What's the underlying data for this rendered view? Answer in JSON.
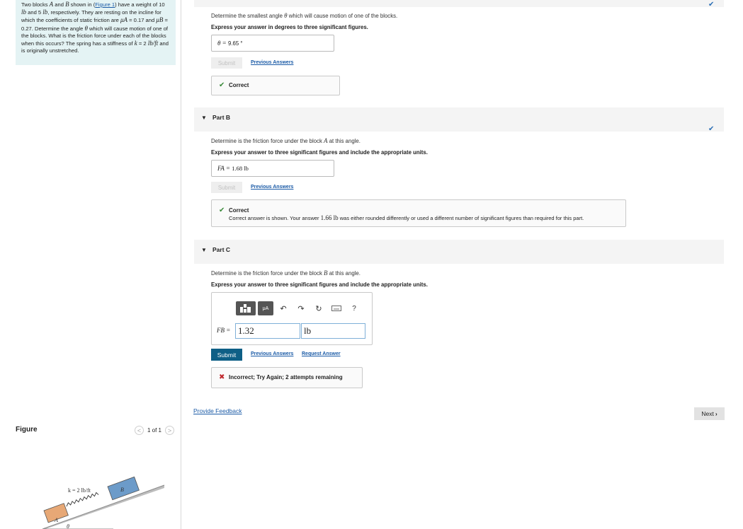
{
  "problem": {
    "t1": "Two blocks ",
    "sym_a": "A",
    "t2": " and ",
    "sym_b": "B",
    "t3": " shown in (",
    "figure_link": "Figure 1",
    "t4": ") have a weight of 10 ",
    "unit1": "lb",
    "t5": " and 5 ",
    "unit2": "lb",
    "t6": ", respectively. They are resting on the incline for which the coefficients of static friction are ",
    "mu_a": "μA",
    "t7": " = 0.17 and ",
    "mu_b": "μB",
    "t8": " = 0.27. Determine the angle ",
    "theta": "θ",
    "t9": " which will cause motion of one of the blocks. What is the friction force under each of the blocks when this occurs? The spring has a stiffness of ",
    "k": "k",
    "t10": " = 2 ",
    "k_unit": "lb/ft",
    "t11": " and is originally unstretched."
  },
  "figure": {
    "title": "Figure",
    "counter": "1 of 1",
    "prev": "<",
    "next": ">",
    "spring_label": "k = 2 lb/ft",
    "block_a": "A",
    "block_b": "B",
    "angle": "θ"
  },
  "part_a": {
    "question_pre": "Determine the smallest angle ",
    "question_sym": "θ",
    "question_post": " which will cause motion of one of the blocks.",
    "instruction": "Express your answer in degrees to three significant figures.",
    "answer_label": "θ = ",
    "answer_value": "9.65 °",
    "submit_label": "Submit",
    "previous_answers": "Previous Answers",
    "feedback_title": "Correct"
  },
  "part_b": {
    "title": "Part B",
    "question_pre": "Determine is the friction force under the block ",
    "question_sym": "A",
    "question_post": " at this angle.",
    "instruction": "Express your answer to three significant figures and include the appropriate units.",
    "answer_label": "FA = ",
    "answer_value": "1.68 lb",
    "submit_label": "Submit",
    "previous_answers": "Previous Answers",
    "feedback_title": "Correct",
    "feedback_detail_pre": "Correct answer is shown. Your answer ",
    "feedback_detail_val": "1.66 lb",
    "feedback_detail_post": " was either rounded differently or used a different number of significant figures than required for this part."
  },
  "part_c": {
    "title": "Part C",
    "question_pre": "Determine is the friction force under the block ",
    "question_sym": "B",
    "question_post": " at this angle.",
    "instruction": "Express your answer to three significant figures and include the appropriate units.",
    "answer_label": "FB = ",
    "value": "1.32",
    "unit": "lb",
    "toolbar_units": "μA",
    "help": "?",
    "submit_label": "Submit",
    "previous_answers": "Previous Answers",
    "request_answer": "Request Answer",
    "feedback": "Incorrect; Try Again; 2 attempts remaining"
  },
  "footer": {
    "provide_feedback": "Provide Feedback",
    "next_label": "Next"
  },
  "colors": {
    "accent": "#0e5f86",
    "link": "#1a5aa6",
    "correct": "#3a8a3a",
    "incorrect": "#c0282d",
    "problem_bg": "#e4f3f4"
  }
}
